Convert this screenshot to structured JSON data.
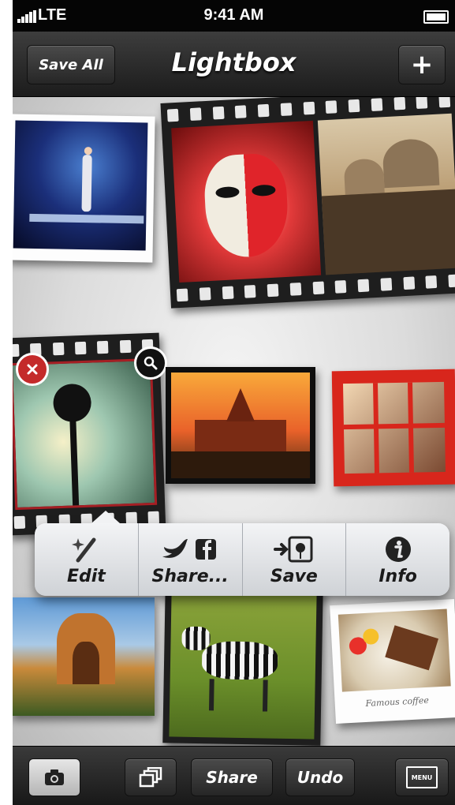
{
  "status_bar": {
    "carrier": "LTE",
    "time": "9:41 AM"
  },
  "nav_bar": {
    "title": "Lightbox",
    "left_button": "Save All",
    "right_button": "+"
  },
  "board": {
    "photos": [
      {
        "name": "concert-performer-photo",
        "frame": "white"
      },
      {
        "name": "venetian-mask-photo",
        "frame": "filmstrip"
      },
      {
        "name": "venice-domes-photo",
        "frame": "filmstrip"
      },
      {
        "name": "street-lamp-photo",
        "frame": "filmstrip",
        "selected": true
      },
      {
        "name": "thai-temple-photo",
        "frame": "black"
      },
      {
        "name": "red-phone-booth-photo",
        "frame": "none"
      },
      {
        "name": "palace-of-fine-arts-photo",
        "frame": "none"
      },
      {
        "name": "zebra-photo",
        "frame": "filmstrip"
      },
      {
        "name": "cake-plate-photo",
        "frame": "white",
        "caption": "Famous coffee"
      }
    ],
    "selection_badges": {
      "delete_icon": "close-icon",
      "zoom_icon": "magnifier-icon"
    }
  },
  "popup_menu": {
    "items": [
      {
        "label": "Edit",
        "icon": "magic-brush-icon"
      },
      {
        "label": "Share...",
        "icon": "twitter-facebook-icon"
      },
      {
        "label": "Save",
        "icon": "save-to-album-icon"
      },
      {
        "label": "Info",
        "icon": "info-icon"
      }
    ]
  },
  "toolbar": {
    "camera_icon": "camera-icon",
    "stack_icon": "stack-icon",
    "share_label": "Share",
    "undo_label": "Undo",
    "menu_label": "MENU"
  },
  "colors": {
    "accent_red": "#c42a2a",
    "board_light": "#f4f4f4",
    "bar_dark": "#1c1c1c"
  }
}
